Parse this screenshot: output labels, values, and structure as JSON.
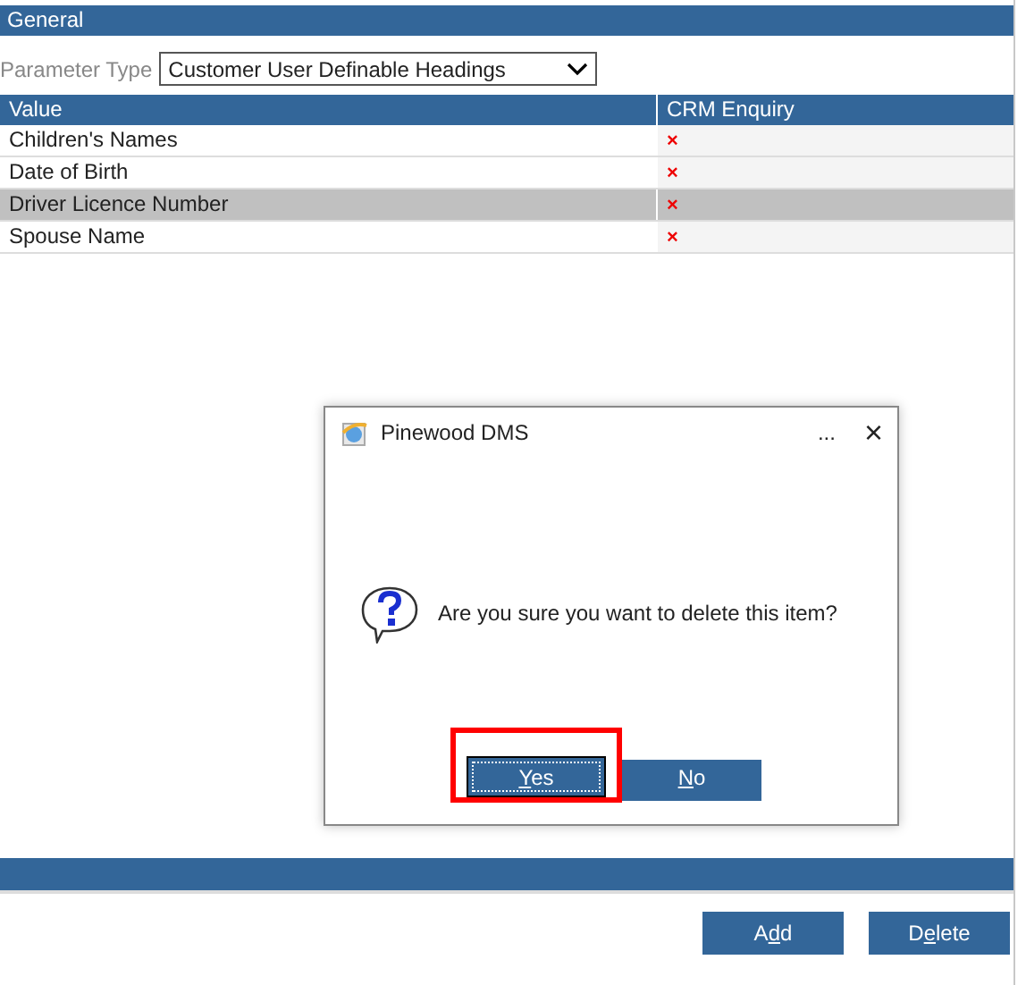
{
  "section": {
    "title": "General"
  },
  "parameter": {
    "label": "Parameter Type",
    "value": "Customer User Definable Headings"
  },
  "table": {
    "columns": [
      "Value",
      "CRM Enquiry"
    ],
    "rows": [
      {
        "value": "Children's Names",
        "crm_enquiry": "×",
        "selected": false
      },
      {
        "value": "Date of Birth",
        "crm_enquiry": "×",
        "selected": false
      },
      {
        "value": "Driver Licence Number",
        "crm_enquiry": "×",
        "selected": true
      },
      {
        "value": "Spouse Name",
        "crm_enquiry": "×",
        "selected": false
      }
    ]
  },
  "buttons": [
    {
      "before": "A",
      "accelerator": "d",
      "after": "d"
    },
    {
      "before": "D",
      "accelerator": "e",
      "after": "lete"
    }
  ],
  "dialog": {
    "title": "Pinewood DMS",
    "more": "...",
    "close": "×",
    "message": "Are you sure you want to delete this item?",
    "buttons": [
      {
        "accelerator": "Y",
        "after": "es",
        "focused": true,
        "highlighted": true
      },
      {
        "accelerator": "N",
        "after": "o",
        "focused": false,
        "highlighted": false
      }
    ]
  }
}
